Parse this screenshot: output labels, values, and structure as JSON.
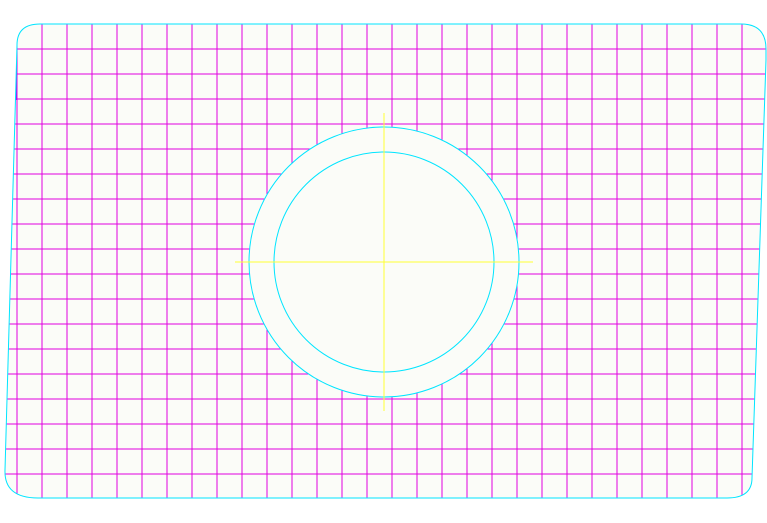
{
  "drawing": {
    "colors": {
      "background": "#FFFFFF",
      "panel_fill": "#FBFCF8",
      "outline": "#00E5FF",
      "grid": "#E000E0",
      "grid_edge": "#6A2CFF",
      "centerline": "#FFFF33"
    },
    "grid": {
      "columns": 29,
      "rows": 19
    },
    "hole": {
      "rings": 2
    }
  }
}
